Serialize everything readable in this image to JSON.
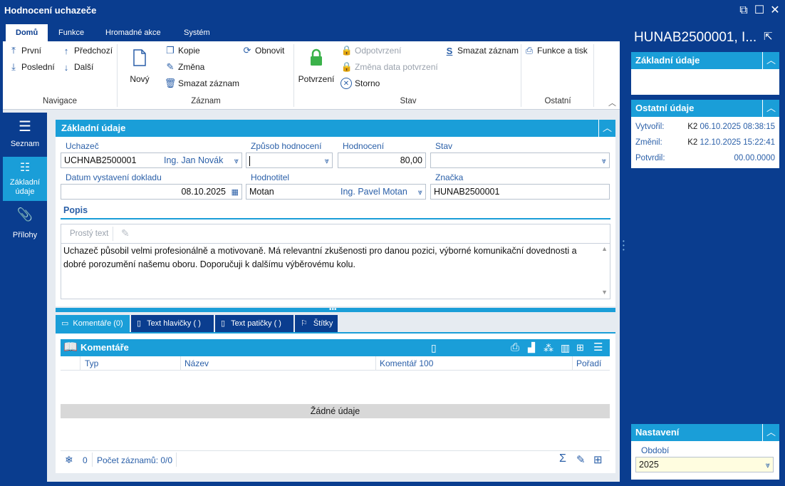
{
  "window": {
    "title": "Hodnocení uchazeče"
  },
  "ribbon": {
    "tabs": [
      "Domů",
      "Funkce",
      "Hromadné akce",
      "Systém"
    ],
    "navigace": {
      "prvni": "První",
      "posledni": "Poslední",
      "predchozi": "Předchozí",
      "dalsi": "Další",
      "label": "Navigace"
    },
    "zaznam": {
      "novy": "Nový",
      "kopie": "Kopie",
      "zmena": "Změna",
      "smazat": "Smazat záznam",
      "obnovit": "Obnovit",
      "label": "Záznam"
    },
    "stav": {
      "potvrzeni": "Potvrzení",
      "odpotvrzeni": "Odpotvrzení",
      "zmena_data": "Změna data potvrzení",
      "storno": "Storno",
      "smazat": "Smazat záznam",
      "label": "Stav"
    },
    "ostatni": {
      "funkce": "Funkce a tisk",
      "label": "Ostatní"
    }
  },
  "leftnav": [
    {
      "label": "Seznam"
    },
    {
      "label": "Základní údaje"
    },
    {
      "label": "Přílohy"
    }
  ],
  "form": {
    "title": "Základní údaje",
    "uchazec_label": "Uchazeč",
    "uchazec_code": "UCHNAB2500001",
    "uchazec_name": "Ing. Jan Novák",
    "zpusob_label": "Způsob hodnocení",
    "zpusob_value": "",
    "hodnoceni_label": "Hodnocení",
    "hodnoceni_value": "80,00",
    "stav_label": "Stav",
    "stav_value": "",
    "datum_label": "Datum vystavení dokladu",
    "datum_value": "08.10.2025",
    "hodnotitel_label": "Hodnotitel",
    "hodnotitel_code": "Motan",
    "hodnotitel_name": "Ing. Pavel Motan",
    "znacka_label": "Značka",
    "znacka_value": "HUNAB2500001",
    "popis_label": "Popis",
    "editor_mode": "Prostý text",
    "popis_text": "Uchazeč působil velmi profesionálně a motivovaně. Má relevantní zkušenosti pro danou pozici, výborné komunikační dovednosti a dobré porozumění našemu oboru. Doporučuji k dalšímu výběrovému kolu."
  },
  "bottom_tabs": [
    "Komentáře (0)",
    "Text hlavičky ( )",
    "Text patičky ( )",
    "Štítky"
  ],
  "comments": {
    "title": "Komentáře",
    "columns": [
      "Typ",
      "Název",
      "Komentář 100",
      "Pořadí"
    ],
    "empty_text": "Žádné údaje",
    "filter_count": "0",
    "record_count": "Počet záznamů: 0/0"
  },
  "right": {
    "header": "HUNAB2500001, I...",
    "zakladni_title": "Základní údaje",
    "ostatni_title": "Ostatní údaje",
    "vytvoril_label": "Vytvořil:",
    "vytvoril_user": "K2",
    "vytvoril_date": "06.10.2025 08:38:15",
    "zmenil_label": "Změnil:",
    "zmenil_user": "K2",
    "zmenil_date": "12.10.2025 15:22:41",
    "potvrdil_label": "Potvrdil:",
    "potvrdil_date": "00.00.0000",
    "nastaveni_title": "Nastavení",
    "obdobi_label": "Období",
    "obdobi_value": "2025"
  },
  "colors": {
    "dark_blue": "#0a3d8f",
    "accent_blue": "#1a9ed8",
    "confirm_green": "#3bb24a"
  }
}
